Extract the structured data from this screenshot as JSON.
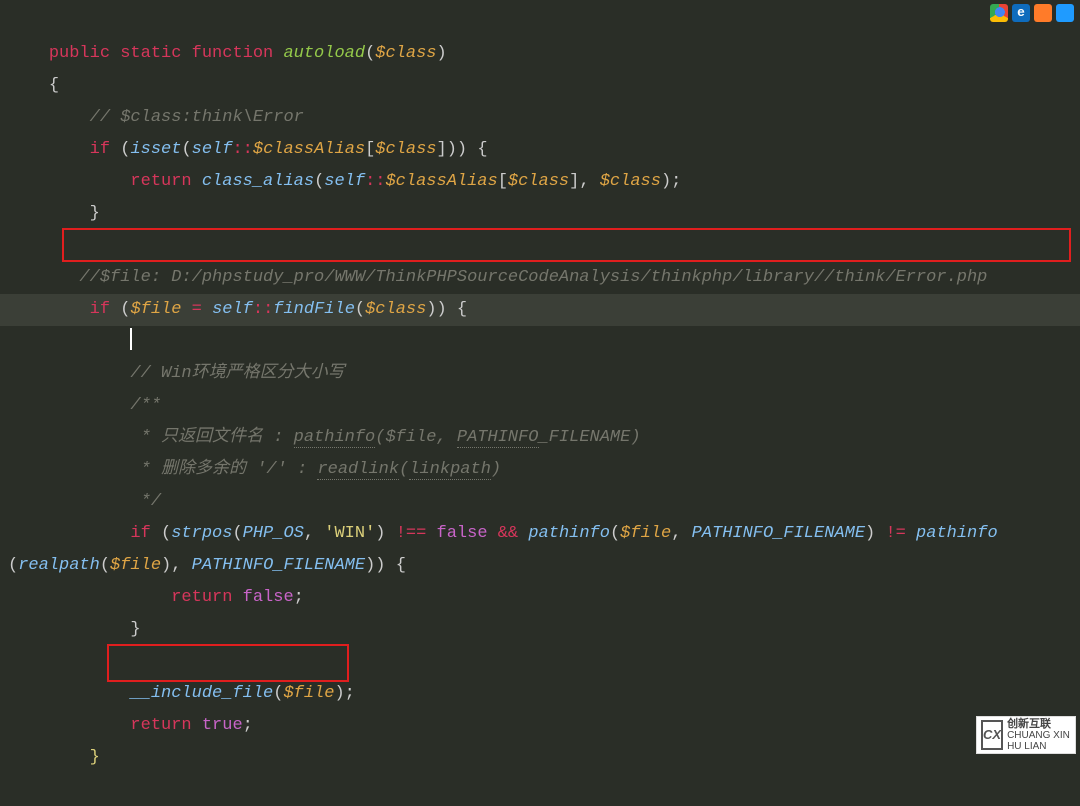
{
  "icons": {
    "chrome": "chrome-icon",
    "edge": "edge-icon",
    "firefox": "firefox-icon",
    "safari": "safari-icon"
  },
  "watermark": {
    "logo": "CX",
    "brand": "创新互联",
    "sub": "CHUANG XIN HU LIAN"
  },
  "code": {
    "l1": {
      "kw": "public static function",
      "fn": "autoload",
      "param": "$class"
    },
    "l2": {
      "brace": "{"
    },
    "l3": {
      "c": "// $class:think\\Error"
    },
    "l4": {
      "kw": "if",
      "fn": "isset",
      "self": "self",
      "scope": "::",
      "prop": "$classAlias",
      "idx": "$class",
      "open": ") {"
    },
    "l5": {
      "kw": "return",
      "fn": "class_alias",
      "self": "self",
      "scope": "::",
      "prop": "$classAlias",
      "idx": "$class",
      "arg2": "$class"
    },
    "l6": {
      "brace": "}"
    },
    "l8": {
      "c": "//$file: D:/phpstudy_pro/WWW/ThinkPHPSourceCodeAnalysis/thinkphp/library//think/Error.php"
    },
    "l9": {
      "kw": "if",
      "var": "$file",
      "op": "=",
      "self": "self",
      "scope": "::",
      "fn": "findFile",
      "arg": "$class",
      "open": ") {"
    },
    "l10": {
      "caret": true
    },
    "l11": {
      "c": "// Win环境严格区分大小写"
    },
    "l12": {
      "c": "/**"
    },
    "l13": {
      "c": " * 只返回文件名 : ",
      "u1": "pathinfo",
      "mid": "($file, ",
      "u2": "PATHINFO",
      "tail": "_FILENAME)"
    },
    "l14": {
      "c": " * 删除多余的 '/' : ",
      "u1": "readlink",
      "open": "(",
      "u2": "linkpath",
      "close": ")"
    },
    "l15": {
      "c": " */"
    },
    "l16": {
      "kw": "if",
      "fn1": "strpos",
      "c1": "PHP_OS",
      "str": "'WIN'",
      "neq": "!==",
      "false": "false",
      "amp": "&&",
      "fn2": "pathinfo",
      "var": "$file",
      "c2": "PATHINFO_FILENAME",
      "ne": "!=",
      "fn3": "pathinfo"
    },
    "l17": {
      "fn": "realpath",
      "var": "$file",
      "c1": "PATHINFO_FILENAME",
      "open": ") {"
    },
    "l18": {
      "kw": "return",
      "false": "false"
    },
    "l19": {
      "brace": "}"
    },
    "l21": {
      "fn": "__include_file",
      "var": "$file"
    },
    "l22": {
      "kw": "return",
      "true": "true"
    },
    "l23": {
      "brace": "}"
    }
  }
}
